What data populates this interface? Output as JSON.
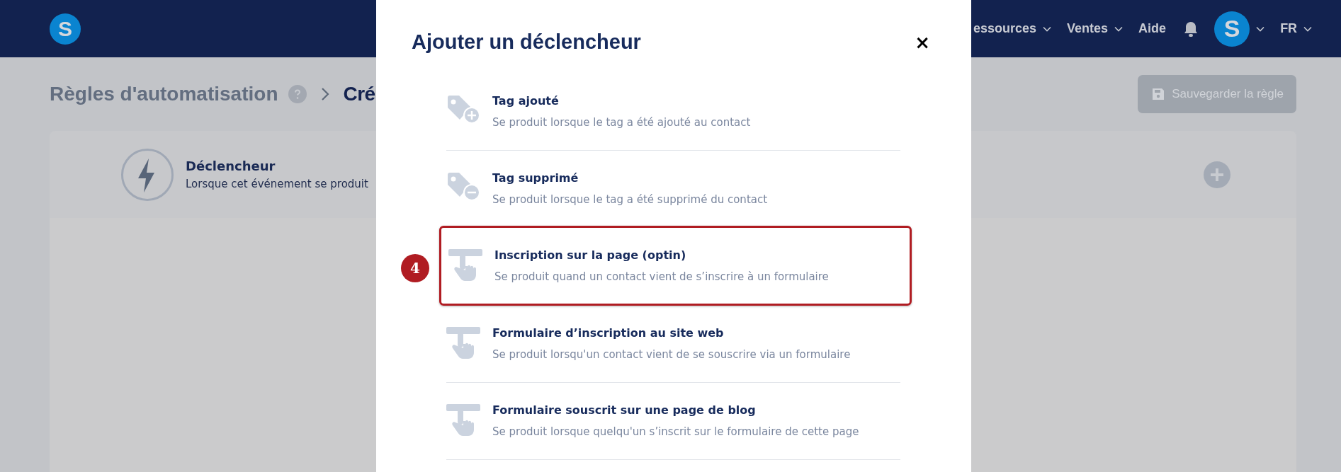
{
  "header": {
    "logo": "S",
    "nav": [
      {
        "label": "essources",
        "dropdown": true
      },
      {
        "label": "Ventes",
        "dropdown": true
      },
      {
        "label": "Aide",
        "dropdown": false
      }
    ],
    "avatar": "S",
    "language": "FR"
  },
  "breadcrumb": [
    "Règles d'automatisation",
    "Cré"
  ],
  "save_button": "Sauvegarder la règle",
  "trigger_card": {
    "title": "Déclencheur",
    "description": "Lorsque cet événement se produit"
  },
  "modal": {
    "title": "Ajouter un déclencheur",
    "close": "×",
    "triggers": [
      {
        "kind": "tag-add",
        "title": "Tag ajouté",
        "description": "Se produit lorsque le tag a été ajouté au contact",
        "highlighted": false
      },
      {
        "kind": "tag-remove",
        "title": "Tag supprimé",
        "description": "Se produit lorsque le tag a été supprimé du contact",
        "highlighted": false
      },
      {
        "kind": "form",
        "title": "Inscription sur la page (optin)",
        "description": "Se produit quand un contact vient de s’inscrire à un formulaire",
        "highlighted": true,
        "step_badge": "4"
      },
      {
        "kind": "form",
        "title": "Formulaire d’inscription au site web",
        "description": "Se produit lorsqu'un contact vient de se souscrire via un formulaire",
        "highlighted": false
      },
      {
        "kind": "form",
        "title": "Formulaire souscrit sur une page de blog",
        "description": "Se produit lorsque quelqu'un s’inscrit sur le formulaire de cette page",
        "highlighted": false
      }
    ]
  }
}
